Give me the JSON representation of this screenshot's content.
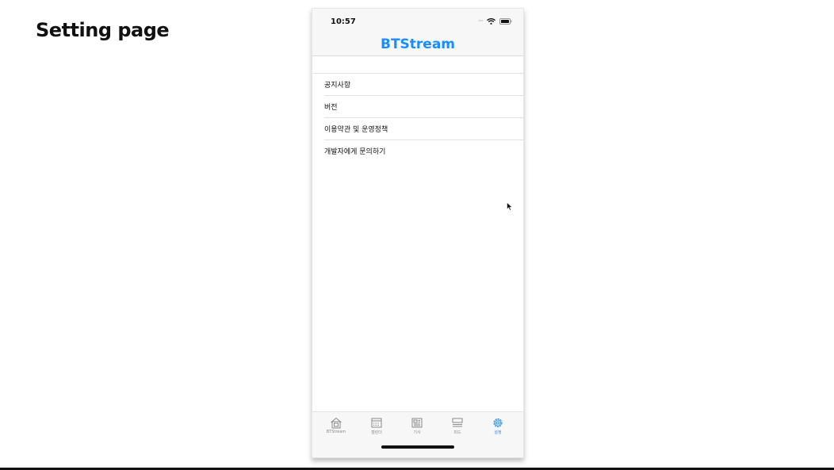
{
  "slide": {
    "title": "Setting page"
  },
  "status_bar": {
    "time": "10:57",
    "signal_icon": "signal-dots-icon",
    "wifi_icon": "wifi-icon",
    "battery_icon": "battery-icon"
  },
  "nav": {
    "title": "BTStream",
    "accent_color": "#1a8cff"
  },
  "settings_list": {
    "items": [
      {
        "label": "공지사항"
      },
      {
        "label": "버전"
      },
      {
        "label": "이용약관 및 운영정책"
      },
      {
        "label": "개발자에게 문의하기"
      }
    ]
  },
  "tab_bar": {
    "tabs": [
      {
        "label": "BTStream",
        "icon": "home-icon",
        "active": false
      },
      {
        "label": "캘린더",
        "icon": "calendar-icon",
        "active": false
      },
      {
        "label": "기사",
        "icon": "news-icon",
        "active": false
      },
      {
        "label": "피드",
        "icon": "feed-icon",
        "active": false
      },
      {
        "label": "설정",
        "icon": "gear-icon",
        "active": true
      }
    ]
  }
}
